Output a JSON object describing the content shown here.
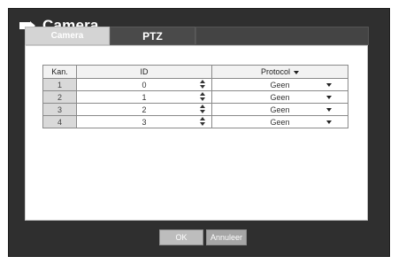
{
  "window": {
    "title": "Camera",
    "icon": "camera-icon"
  },
  "tabs": [
    {
      "label": "Camera",
      "active": true
    },
    {
      "label": "PTZ",
      "active": false
    }
  ],
  "table": {
    "headers": {
      "channel": "Kan.",
      "id": "ID",
      "protocol": "Protocol"
    },
    "rows": [
      {
        "channel": "1",
        "id": "0",
        "protocol": "Geen"
      },
      {
        "channel": "2",
        "id": "1",
        "protocol": "Geen"
      },
      {
        "channel": "3",
        "id": "2",
        "protocol": "Geen"
      },
      {
        "channel": "4",
        "id": "3",
        "protocol": "Geen"
      }
    ]
  },
  "buttons": {
    "ok": "OK",
    "cancel": "Annuleer"
  },
  "colors": {
    "frame": "#2f2f2f",
    "panel": "#ffffff",
    "tab_active": "#d4d4d4",
    "button": "#bdbdbd"
  }
}
